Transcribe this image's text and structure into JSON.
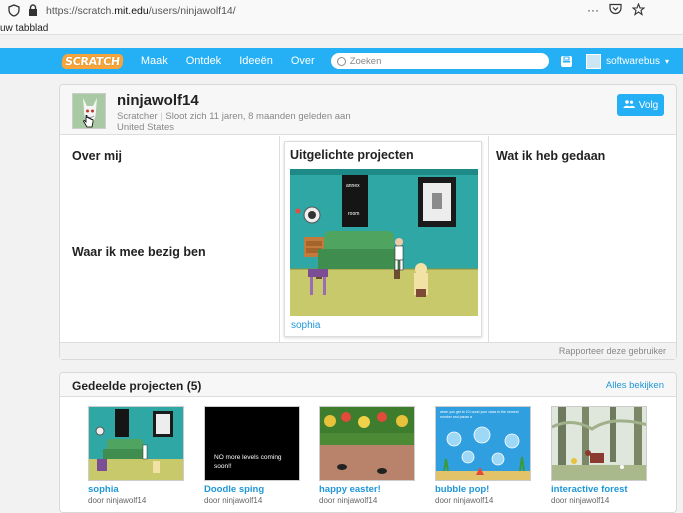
{
  "browser": {
    "url_prefix": "https://scratch.",
    "url_domain": "mit.edu",
    "url_suffix": "/users/ninjawolf14/",
    "tab_label": "uw tabblad",
    "more_icon": "···"
  },
  "nav": {
    "logo": "SCRATCH",
    "links": [
      "Maak",
      "Ontdek",
      "Ideeën",
      "Over"
    ],
    "search_placeholder": "Zoeken",
    "username": "softwarebus",
    "caret": "▾"
  },
  "profile": {
    "username": "ninjawolf14",
    "role": "Scratcher",
    "joined": "Sloot zich 11 jaren, 8 maanden geleden aan",
    "country": "United States",
    "follow_label": "Volg",
    "about_title": "Over mij",
    "working_title": "Waar ik mee bezig ben",
    "featured_title": "Uitgelichte projecten",
    "featured_project": "sophia",
    "featured_sign": "annex",
    "featured_room": "room",
    "activity_title": "Wat ik heb gedaan",
    "report_label": "Rapporteer deze gebruiker"
  },
  "shared": {
    "title": "Gedeelde projecten (5)",
    "see_all": "Alles bekijken",
    "projects": [
      {
        "title": "sophia",
        "by": "door ninjawolf14"
      },
      {
        "title": "Doodle sping",
        "by": "door ninjawolf14",
        "thumb_text": "NO more levels coming soon!!"
      },
      {
        "title": "happy easter!",
        "by": "door ninjawolf14"
      },
      {
        "title": "bubble pop!",
        "by": "door ninjawolf14",
        "thumb_text": "when you get to 10 round your class to the nearest number and pause a"
      },
      {
        "title": "interactive forest",
        "by": "door ninjawolf14"
      }
    ]
  },
  "colors": {
    "nav": "#25aff4",
    "link": "#1e97d7",
    "logo": "#f7a43a"
  }
}
